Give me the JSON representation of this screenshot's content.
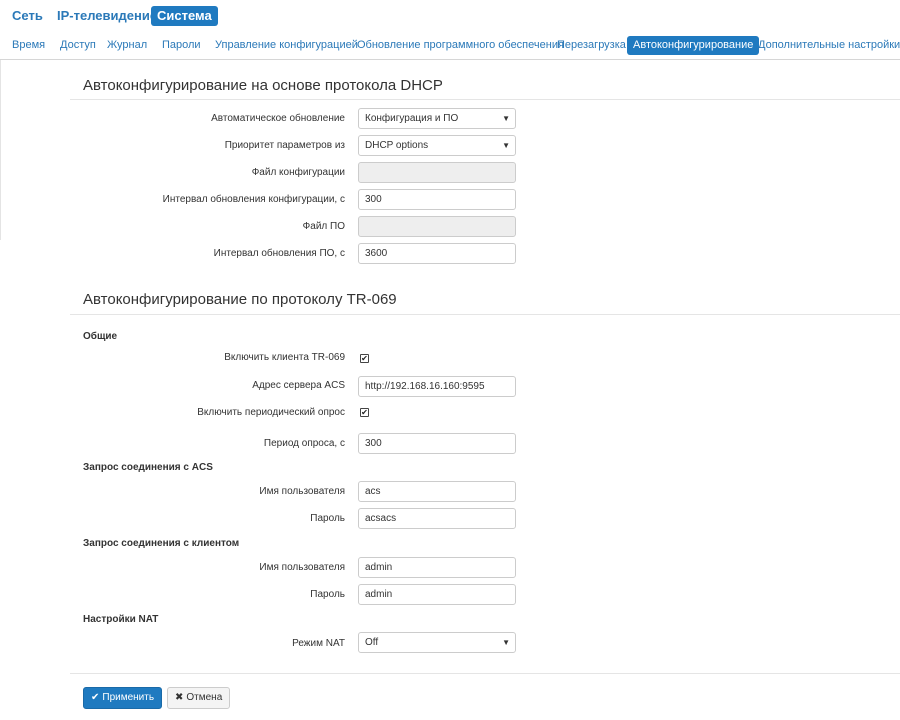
{
  "topnav": {
    "items": [
      {
        "label": "Сеть",
        "active": false
      },
      {
        "label": "IP-телевидение",
        "active": false
      },
      {
        "label": "Система",
        "active": true
      }
    ]
  },
  "subnav": {
    "items": [
      {
        "label": "Время",
        "active": false
      },
      {
        "label": "Доступ",
        "active": false
      },
      {
        "label": "Журнал",
        "active": false
      },
      {
        "label": "Пароли",
        "active": false
      },
      {
        "label": "Управление конфигурацией",
        "active": false
      },
      {
        "label": "Обновление программного обеспечения",
        "active": false
      },
      {
        "label": "Перезагрузка",
        "active": false
      },
      {
        "label": "Автоконфигурирование",
        "active": true
      },
      {
        "label": "Дополнительные настройки",
        "active": false
      }
    ]
  },
  "dhcp": {
    "title": "Автоконфигурирование на основе протокола DHCP",
    "auto_update": {
      "label": "Автоматическое обновление",
      "value": "Конфигурация и ПО"
    },
    "priority": {
      "label": "Приоритет параметров из",
      "value": "DHCP options"
    },
    "config_file": {
      "label": "Файл конфигурации",
      "value": ""
    },
    "config_interval": {
      "label": "Интервал обновления конфигурации, с",
      "value": "300"
    },
    "fw_file": {
      "label": "Файл ПО",
      "value": ""
    },
    "fw_interval": {
      "label": "Интервал обновления ПО, с",
      "value": "3600"
    }
  },
  "tr069": {
    "title": "Автоконфигурирование по протоколу TR-069",
    "general": {
      "title": "Общие",
      "enable_client": {
        "label": "Включить клиента TR-069",
        "checked": true,
        "mark": "✔"
      },
      "acs_address": {
        "label": "Адрес сервера ACS",
        "value": "http://192.168.16.160:9595"
      },
      "enable_periodic": {
        "label": "Включить периодический опрос",
        "checked": true,
        "mark": "✔"
      },
      "period": {
        "label": "Период опроса, с",
        "value": "300"
      }
    },
    "acs_request": {
      "title": "Запрос соединения с ACS",
      "username": {
        "label": "Имя пользователя",
        "value": "acs"
      },
      "password": {
        "label": "Пароль",
        "value": "acsacs"
      }
    },
    "client_request": {
      "title": "Запрос соединения с клиентом",
      "username": {
        "label": "Имя пользователя",
        "value": "admin"
      },
      "password": {
        "label": "Пароль",
        "value": "admin"
      }
    },
    "nat": {
      "title": "Настройки NAT",
      "mode": {
        "label": "Режим NAT",
        "value": "Off"
      }
    }
  },
  "buttons": {
    "apply": {
      "icon": "check-icon",
      "glyph": "✔",
      "label": "Применить"
    },
    "cancel": {
      "icon": "close-icon",
      "glyph": "✖",
      "label": "Отмена"
    }
  },
  "colors": {
    "accent": "#1f7ac0",
    "link": "#2b79b8"
  }
}
